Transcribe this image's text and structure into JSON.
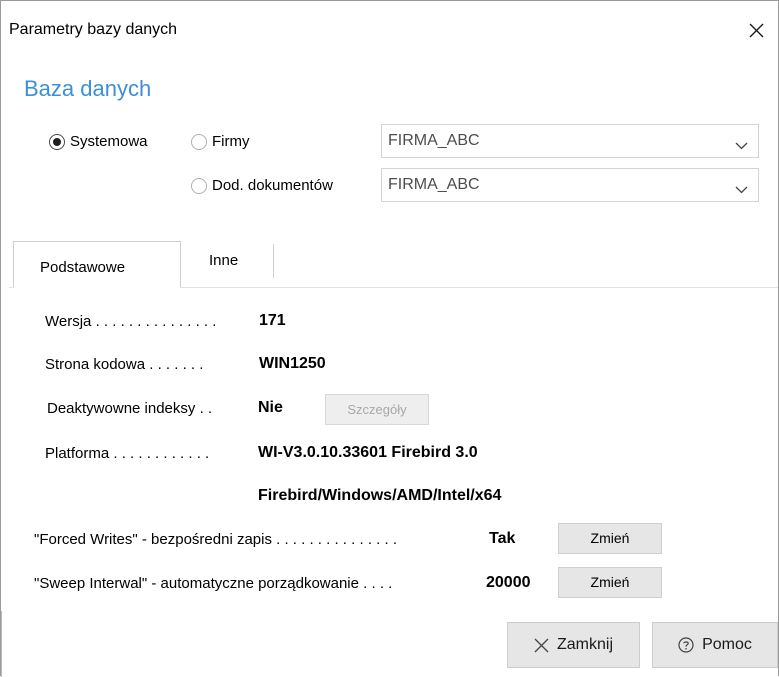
{
  "window": {
    "title": "Parametry bazy danych"
  },
  "section": {
    "title": "Baza danych"
  },
  "database_type": {
    "options": [
      {
        "label": "Systemowa",
        "checked": true
      },
      {
        "label": "Firmy",
        "checked": false
      },
      {
        "label": "Dod. dokumentów",
        "checked": false
      }
    ],
    "firmy_value": "FIRMA_ABC",
    "dod_value": "FIRMA_ABC"
  },
  "tabs": [
    {
      "label": "Podstawowe",
      "active": true
    },
    {
      "label": "Inne",
      "active": false
    }
  ],
  "params": {
    "wersja_label": "Wersja . . . . . . . . . . . . . . .",
    "wersja_value": "171",
    "strona_label": "Strona kodowa . . . . . . .",
    "strona_value": "WIN1250",
    "indeksy_label": "Deaktywowne indeksy . .",
    "indeksy_value": "Nie",
    "szczegoly_label": "Szczegóły",
    "platforma_label": "Platforma . . . . . . . . . . . .",
    "platforma_value_1": "WI-V3.0.10.33601 Firebird 3.0",
    "platforma_value_2": "Firebird/Windows/AMD/Intel/x64",
    "forced_label": "\"Forced Writes\" - bezpośredni zapis . . . . . . . . . . . . . . .",
    "forced_value": "Tak",
    "sweep_label": "\"Sweep Interwal\" - automatyczne porządkowanie . . . .",
    "sweep_value": "20000",
    "zmien_label": "Zmień"
  },
  "footer": {
    "close_label": "Zamknij",
    "help_label": "Pomoc"
  }
}
